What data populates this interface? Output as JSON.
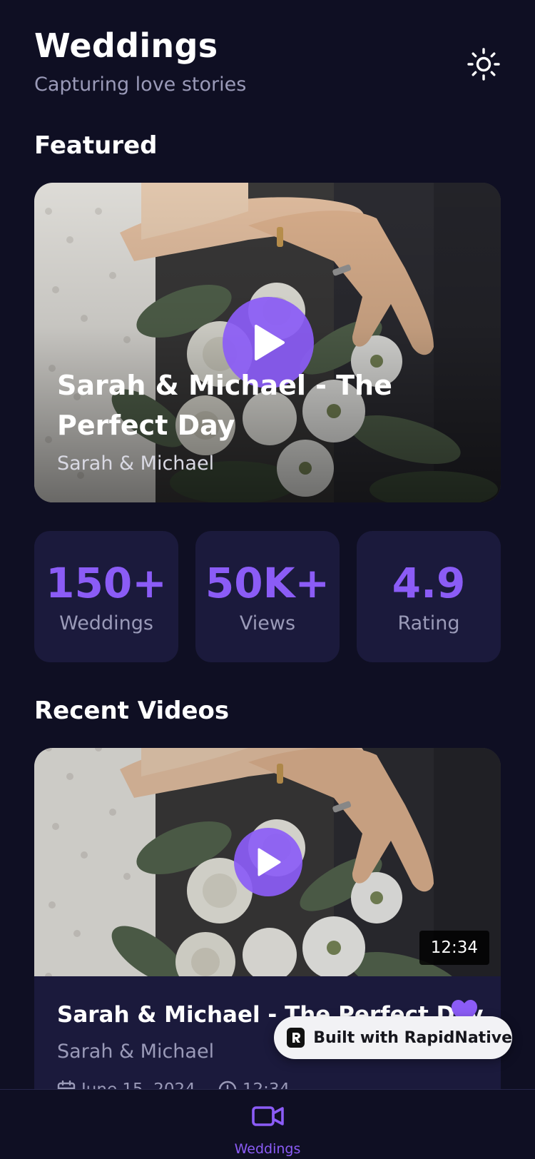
{
  "header": {
    "title": "Weddings",
    "subtitle": "Capturing love stories",
    "theme_icon": "sun-icon"
  },
  "featured": {
    "section_title": "Featured",
    "title": "Sarah & Michael - The Perfect Day",
    "couple": "Sarah & Michael",
    "play_icon": "play-icon"
  },
  "stats": [
    {
      "value": "150+",
      "label": "Weddings"
    },
    {
      "value": "50K+",
      "label": "Views"
    },
    {
      "value": "4.9",
      "label": "Rating"
    }
  ],
  "recent": {
    "section_title": "Recent Videos",
    "videos": [
      {
        "title": "Sarah & Michael - The Perfect Day",
        "couple": "Sarah & Michael",
        "duration": "12:34",
        "date": "June 15, 2024",
        "length": "12:34",
        "favorite": true
      }
    ]
  },
  "badge": {
    "text": "Built with RapidNative"
  },
  "tabbar": {
    "items": [
      {
        "label": "Weddings",
        "icon": "video-camera-icon",
        "active": true
      }
    ]
  },
  "colors": {
    "background": "#0f0f23",
    "card": "#1b1a3c",
    "accent": "#8b5cf6",
    "muted_text": "#9a9ab8"
  }
}
